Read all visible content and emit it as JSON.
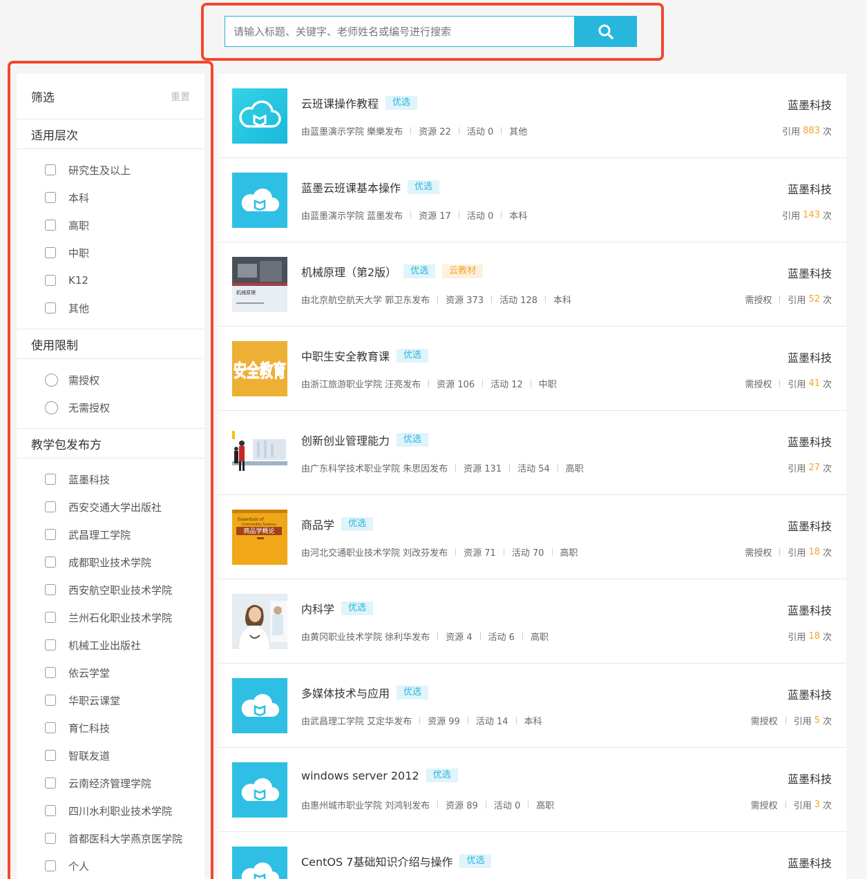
{
  "search": {
    "placeholder": "请输入标题、关键字、老师姓名或编号进行搜索"
  },
  "sidebar": {
    "title": "筛选",
    "reset": "重置",
    "sections": [
      {
        "title": "适用层次",
        "type": "checkbox",
        "options": [
          "研究生及以上",
          "本科",
          "高职",
          "中职",
          "K12",
          "其他"
        ]
      },
      {
        "title": "使用限制",
        "type": "radio",
        "options": [
          "需授权",
          "无需授权"
        ]
      },
      {
        "title": "教学包发布方",
        "type": "checkbox",
        "options": [
          "蓝墨科技",
          "西安交通大学出版社",
          "武昌理工学院",
          "成都职业技术学院",
          "西安航空职业技术学院",
          "兰州石化职业技术学院",
          "机械工业出版社",
          "依云学堂",
          "华职云课堂",
          "育仁科技",
          "智联友道",
          "云南经济管理学院",
          "四川水利职业技术学院",
          "首都医科大学燕京医学院",
          "个人"
        ]
      }
    ]
  },
  "labels": {
    "cite_prefix": "引用",
    "cite_suffix": "次",
    "auth": "需授权"
  },
  "colors": {
    "accent": "#27b6dc",
    "highlight": "#f4472f",
    "orange": "#f5a623"
  },
  "courses": [
    {
      "title": "云班课操作教程",
      "tags": [
        "优选"
      ],
      "publisher": "由蓝墨演示学院 樂樂发布",
      "resources": "资源 22",
      "activities": "活动 0",
      "level": "其他",
      "org": "蓝墨科技",
      "auth": false,
      "cites": "883",
      "thumb": "cloud-flat-icon"
    },
    {
      "title": "蓝墨云班课基本操作",
      "tags": [
        "优选"
      ],
      "publisher": "由蓝墨演示学院 蓝墨发布",
      "resources": "资源 17",
      "activities": "活动 0",
      "level": "本科",
      "org": "蓝墨科技",
      "auth": false,
      "cites": "143",
      "thumb": "cloud-icon"
    },
    {
      "title": "机械原理（第2版）",
      "tags": [
        "优选",
        "云教材"
      ],
      "publisher": "由北京航空航天大学 郭卫东发布",
      "resources": "资源 373",
      "activities": "活动 128",
      "level": "本科",
      "org": "蓝墨科技",
      "auth": true,
      "cites": "52",
      "thumb": "book-mechanics",
      "cover_text": "机械原理"
    },
    {
      "title": "中职生安全教育课",
      "tags": [
        "优选"
      ],
      "publisher": "由浙江旅游职业学院 汪亮发布",
      "resources": "资源 106",
      "activities": "活动 12",
      "level": "中职",
      "org": "蓝墨科技",
      "auth": true,
      "cites": "41",
      "thumb": "safety-education",
      "cover_text": "安全教育"
    },
    {
      "title": "创新创业管理能力",
      "tags": [
        "优选"
      ],
      "publisher": "由广东科学技术职业学院 朱思因发布",
      "resources": "资源 131",
      "activities": "活动 54",
      "level": "高职",
      "org": "蓝墨科技",
      "auth": false,
      "cites": "27",
      "thumb": "business-people"
    },
    {
      "title": "商品学",
      "tags": [
        "优选"
      ],
      "publisher": "由河北交通职业技术学院 刘改芬发布",
      "resources": "资源 71",
      "activities": "活动 70",
      "level": "高职",
      "org": "蓝墨科技",
      "auth": true,
      "cites": "18",
      "thumb": "book-commodity",
      "cover_text": "商品学概论"
    },
    {
      "title": "内科学",
      "tags": [
        "优选"
      ],
      "publisher": "由黄冈职业技术学院 徐利华发布",
      "resources": "资源 4",
      "activities": "活动 6",
      "level": "高职",
      "org": "蓝墨科技",
      "auth": false,
      "cites": "18",
      "thumb": "doctor-photo"
    },
    {
      "title": "多媒体技术与应用",
      "tags": [
        "优选"
      ],
      "publisher": "由武昌理工学院 艾定华发布",
      "resources": "资源 99",
      "activities": "活动 14",
      "level": "本科",
      "org": "蓝墨科技",
      "auth": true,
      "cites": "5",
      "thumb": "cloud-icon"
    },
    {
      "title": "windows server 2012",
      "tags": [
        "优选"
      ],
      "publisher": "由惠州城市职业学院 刘鸿钊发布",
      "resources": "资源 89",
      "activities": "活动 0",
      "level": "高职",
      "org": "蓝墨科技",
      "auth": true,
      "cites": "3",
      "thumb": "cloud-icon"
    },
    {
      "title": "CentOS 7基础知识介绍与操作",
      "tags": [
        "优选"
      ],
      "publisher": "",
      "resources": "",
      "activities": "",
      "level": "",
      "org": "蓝墨科技",
      "auth": false,
      "cites": "",
      "thumb": "cloud-icon"
    }
  ]
}
